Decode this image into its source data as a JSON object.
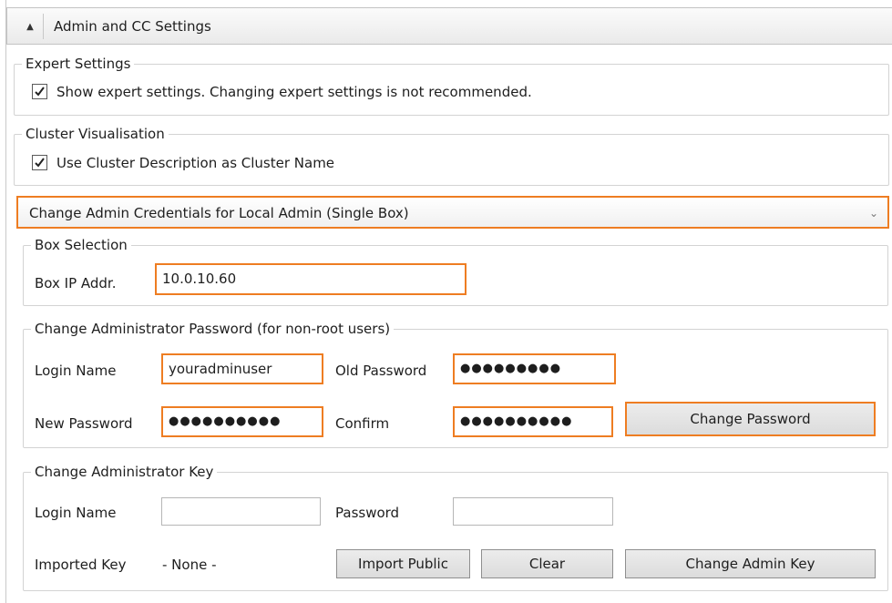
{
  "header": {
    "title": "Admin and CC Settings",
    "collapse_icon": "triangle-up-icon"
  },
  "expert_settings": {
    "legend": "Expert Settings",
    "checkbox_label": "Show expert settings. Changing expert settings is not recommended.",
    "checked": true
  },
  "cluster_visualisation": {
    "legend": "Cluster Visualisation",
    "checkbox_label": "Use Cluster Description as Cluster Name",
    "checked": true
  },
  "credentials_dropdown": {
    "selected": "Change Admin Credentials for Local Admin (Single Box)",
    "arrow_icon": "chevron-down-icon"
  },
  "box_selection": {
    "legend": "Box Selection",
    "ip_label": "Box IP Addr.",
    "ip_value": "10.0.10.60"
  },
  "change_password": {
    "legend": "Change Administrator Password (for non-root users)",
    "login_label": "Login Name",
    "login_value": "youradminuser",
    "old_password_label": "Old Password",
    "old_password_mask": "●●●●●●●●●",
    "new_password_label": "New Password",
    "new_password_mask": "●●●●●●●●●●",
    "confirm_label": "Confirm",
    "confirm_mask": "●●●●●●●●●●",
    "button_label": "Change Password"
  },
  "change_key": {
    "legend": "Change Administrator Key",
    "login_label": "Login Name",
    "login_value": "",
    "password_label": "Password",
    "password_value": "",
    "imported_key_label": "Imported Key",
    "imported_key_value": "- None -",
    "import_button": "Import Public",
    "clear_button": "Clear",
    "change_key_button": "Change Admin Key"
  },
  "colors": {
    "highlight": "#ee7d22",
    "border": "#d3d3d3"
  }
}
